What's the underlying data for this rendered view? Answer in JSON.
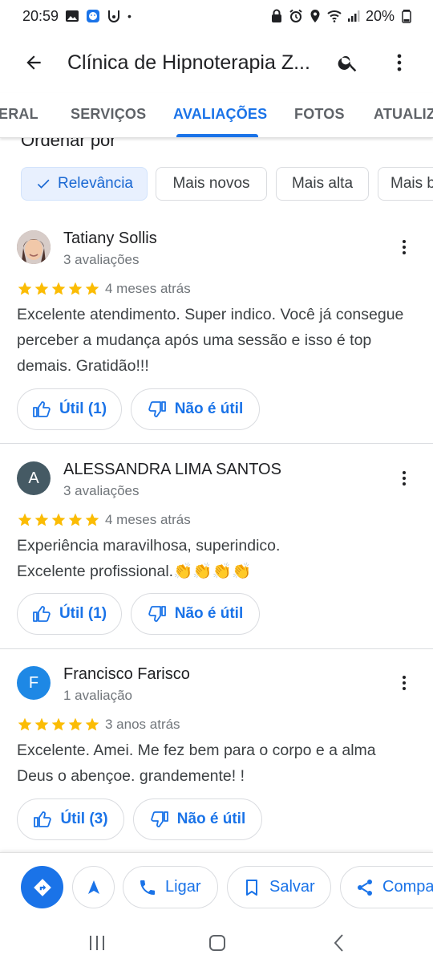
{
  "status_bar": {
    "time": "20:59",
    "dot": "•",
    "battery": "20%"
  },
  "app_bar": {
    "title": "Clínica de Hipnoterapia Z..."
  },
  "tabs": [
    {
      "label": "ERAL",
      "active": false
    },
    {
      "label": "SERVIÇOS",
      "active": false
    },
    {
      "label": "AVALIAÇÕES",
      "active": true
    },
    {
      "label": "FOTOS",
      "active": false
    },
    {
      "label": "ATUALIZ",
      "active": false
    }
  ],
  "sort": {
    "title": "Ordenar por",
    "chips": [
      {
        "label": "Relevância",
        "selected": true
      },
      {
        "label": "Mais novos",
        "selected": false
      },
      {
        "label": "Mais alta",
        "selected": false
      },
      {
        "label": "Mais b",
        "selected": false
      }
    ]
  },
  "reviews": [
    {
      "name": "Tatiany Sollis",
      "count": "3 avaliações",
      "avatar_initial": "",
      "avatar_color": "#8d6e63",
      "rating": 5,
      "date": "4 meses atrás",
      "text": "Excelente atendimento. Super indico. Você já consegue\nperceber a mudança após uma sessão e isso é top\ndemais. Gratidão!!!",
      "helpful": "Útil (1)",
      "not_helpful": "Não é útil"
    },
    {
      "name": "ALESSANDRA LIMA SANTOS",
      "count": "3 avaliações",
      "avatar_initial": "A",
      "avatar_color": "#455a64",
      "rating": 5,
      "date": "4 meses atrás",
      "text": "Experiência maravilhosa, superindico.\nExcelente profissional.👏👏👏👏",
      "helpful": "Útil (1)",
      "not_helpful": "Não é útil"
    },
    {
      "name": "Francisco Farisco",
      "count": "1 avaliação",
      "avatar_initial": "F",
      "avatar_color": "#1e88e5",
      "rating": 5,
      "date": "3 anos atrás",
      "text": "Excelente. Amei. Me fez bem para o corpo e a alma\nDeus o abençoe. grandemente! !",
      "helpful": "Útil (3)",
      "not_helpful": "Não é útil"
    }
  ],
  "actions": {
    "call": "Ligar",
    "save": "Salvar",
    "share": "Compa"
  },
  "colors": {
    "accent": "#1a73e8",
    "star": "#fbbc04"
  }
}
